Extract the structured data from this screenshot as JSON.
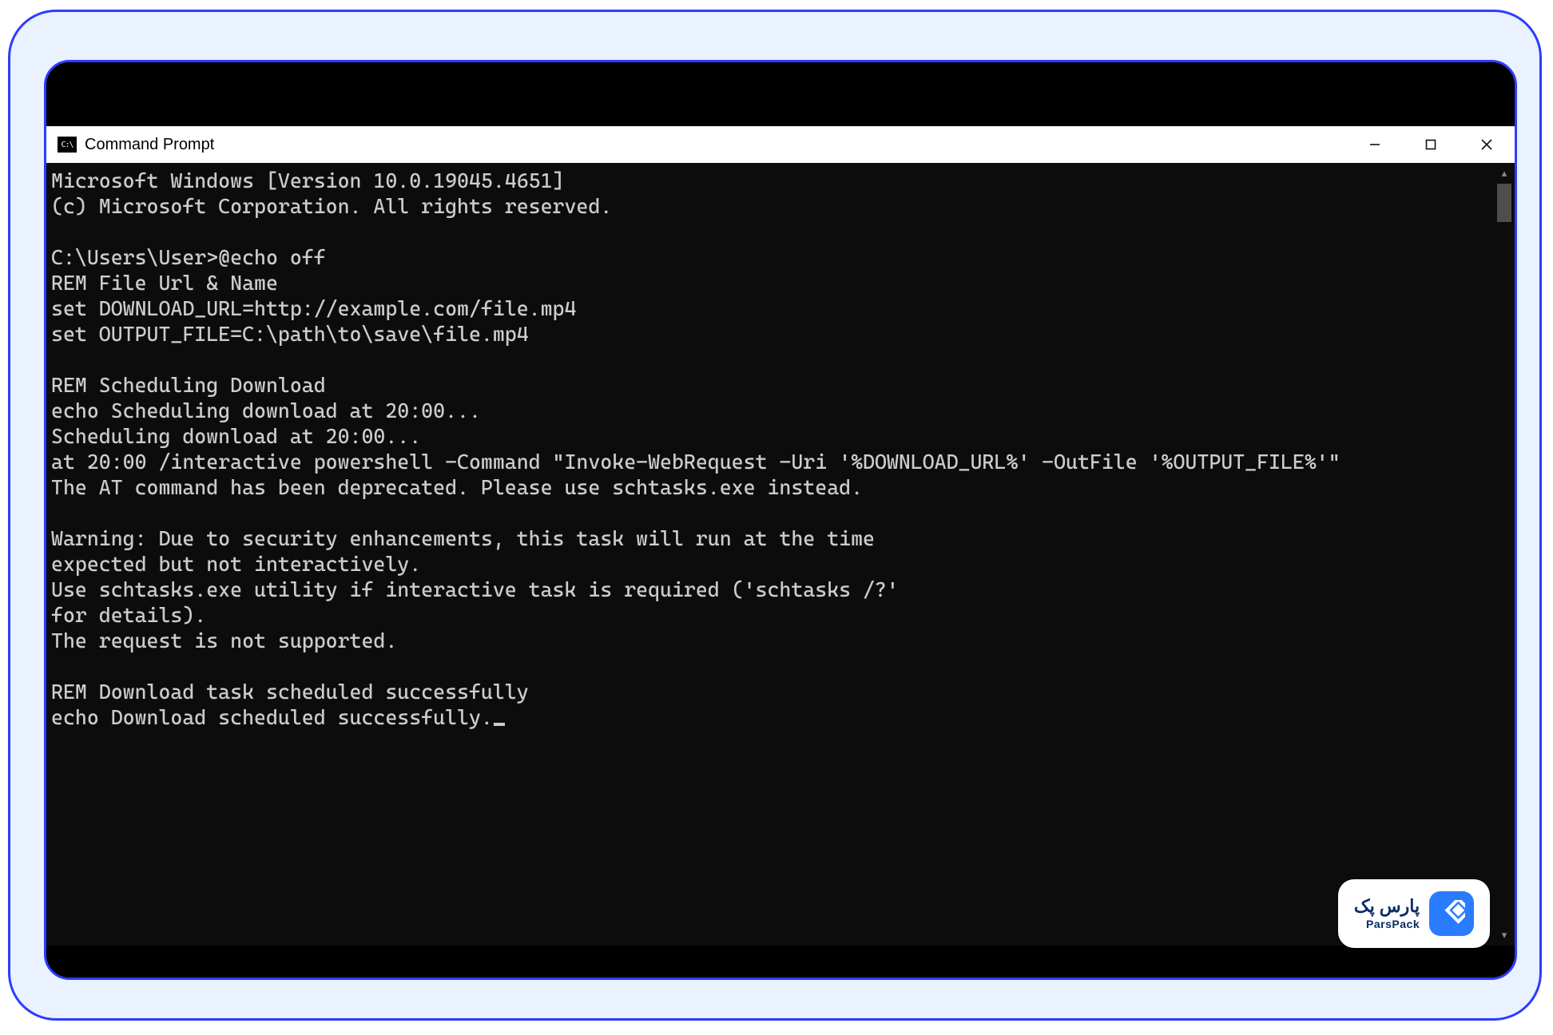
{
  "window": {
    "title": "Command Prompt",
    "app_icon_label": "C:\\"
  },
  "terminal": {
    "lines": [
      "Microsoft Windows [Version 10.0.19045.4651]",
      "(c) Microsoft Corporation. All rights reserved.",
      "",
      "C:\\Users\\User>@echo off",
      "REM File Url & Name",
      "set DOWNLOAD_URL=http://example.com/file.mp4",
      "set OUTPUT_FILE=C:\\path\\to\\save\\file.mp4",
      "",
      "REM Scheduling Download",
      "echo Scheduling download at 20:00...",
      "Scheduling download at 20:00...",
      "at 20:00 /interactive powershell -Command \"Invoke-WebRequest -Uri '%DOWNLOAD_URL%' -OutFile '%OUTPUT_FILE%'\"",
      "The AT command has been deprecated. Please use schtasks.exe instead.",
      "",
      "Warning: Due to security enhancements, this task will run at the time",
      "expected but not interactively.",
      "Use schtasks.exe utility if interactive task is required ('schtasks /?'",
      "for details).",
      "The request is not supported.",
      "",
      "REM Download task scheduled successfully",
      "echo Download scheduled successfully."
    ]
  },
  "watermark": {
    "brand_fa": "پارس پک",
    "brand_en": "ParsPack"
  }
}
